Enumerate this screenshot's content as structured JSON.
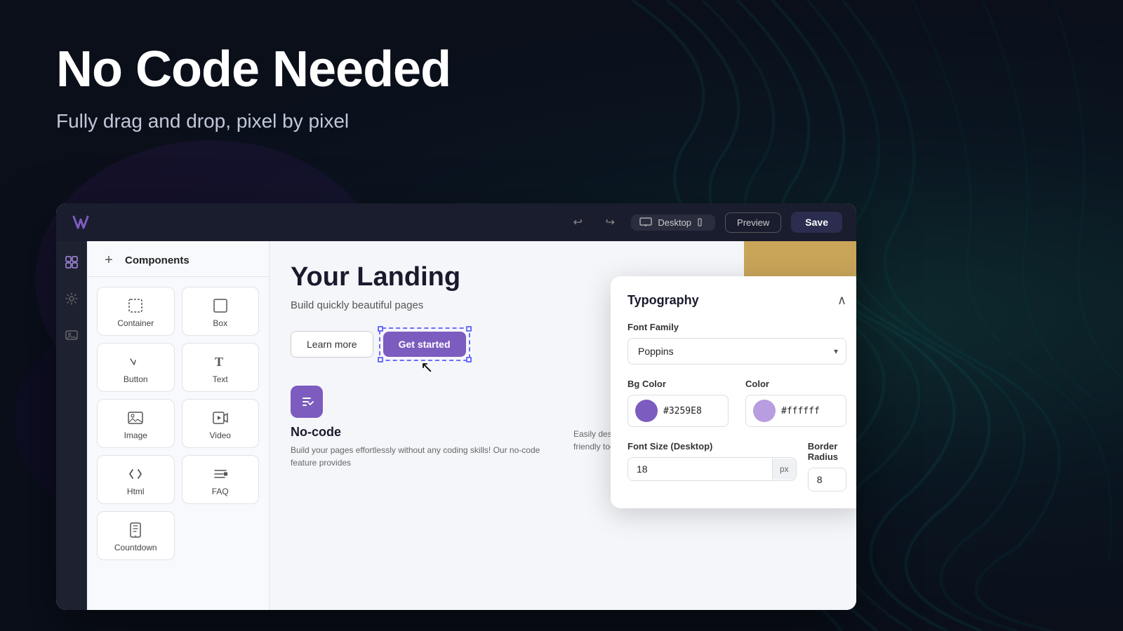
{
  "hero": {
    "title": "No Code Needed",
    "subtitle": "Fully drag and drop, pixel by pixel"
  },
  "editor": {
    "logo_text": "W",
    "topbar": {
      "device_label": "Desktop",
      "preview_label": "Preview",
      "save_label": "Save"
    },
    "components": {
      "header": "Components",
      "add_label": "+",
      "items": [
        {
          "id": "container",
          "label": "Container",
          "icon": "⊡"
        },
        {
          "id": "box",
          "label": "Box",
          "icon": "□"
        },
        {
          "id": "button",
          "label": "Button",
          "icon": "⌲"
        },
        {
          "id": "text",
          "label": "Text",
          "icon": "T"
        },
        {
          "id": "image",
          "label": "Image",
          "icon": "🖼"
        },
        {
          "id": "video",
          "label": "Video",
          "icon": "▷"
        },
        {
          "id": "html",
          "label": "Html",
          "icon": "<>"
        },
        {
          "id": "faq",
          "label": "FAQ",
          "icon": "≡"
        },
        {
          "id": "countdown",
          "label": "Countdown",
          "icon": "⌛"
        }
      ]
    },
    "canvas": {
      "heading": "Your Landing",
      "subtext": "Build quickly beautiful pages",
      "btn_learn": "Learn more",
      "btn_get_started": "Get started",
      "feature_title": "No-code",
      "feature_text": "Build your pages effortlessly without any coding skills! Our no-code feature provides",
      "feature_text2": "Easily design your pages with our drag-and-drop feature! This user-friendly tool lets you"
    }
  },
  "typography_panel": {
    "title": "Typography",
    "font_family_label": "Font Family",
    "font_family_value": "Poppins",
    "bg_color_label": "Bg Color",
    "bg_color_value": "#3259E8",
    "color_label": "Color",
    "color_value": "#ffffff",
    "font_size_label": "Font Size (Desktop)",
    "font_size_value": "18",
    "font_size_unit": "px",
    "border_radius_label": "Border Radius",
    "border_radius_value": "8"
  }
}
